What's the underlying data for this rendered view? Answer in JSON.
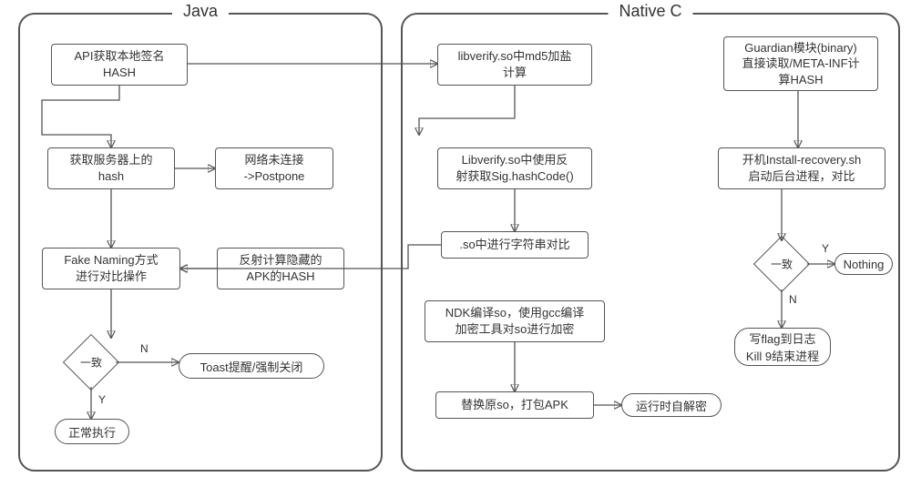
{
  "panels": {
    "java": {
      "title": "Java"
    },
    "native": {
      "title": "Native C"
    }
  },
  "java": {
    "api_hash": "API获取本地签名\nHASH",
    "server_hash": "获取服务器上的\nhash",
    "net_fail": "网络未连接\n->Postpone",
    "fake_naming": "Fake Naming方式\n进行对比操作",
    "reflect_apk": "反射计算隐藏的\nAPK的HASH",
    "decision": "一致",
    "toast": "Toast提醒/强制关闭",
    "normal": "正常执行"
  },
  "native": {
    "md5_salt": "libverify.so中md5加盐\n计算",
    "reflect_sig": "Libverify.so中使用反\n射获取Sig.hashCode()",
    "str_compare": ".so中进行字符串对比",
    "ndk_build": "NDK编译so，使用gcc编译\n加密工具对so进行加密",
    "replace_so": "替换原so，打包APK",
    "self_decrypt": "运行时自解密",
    "guardian": "Guardian模块(binary)\n直接读取/META-INF计\n算HASH",
    "install_recovery": "开机Install-recovery.sh\n启动后台进程，对比",
    "decision": "一致",
    "nothing": "Nothing",
    "flag_kill": "写flag到日志\nKill 9结束进程"
  },
  "labels": {
    "yes": "Y",
    "no": "N"
  }
}
